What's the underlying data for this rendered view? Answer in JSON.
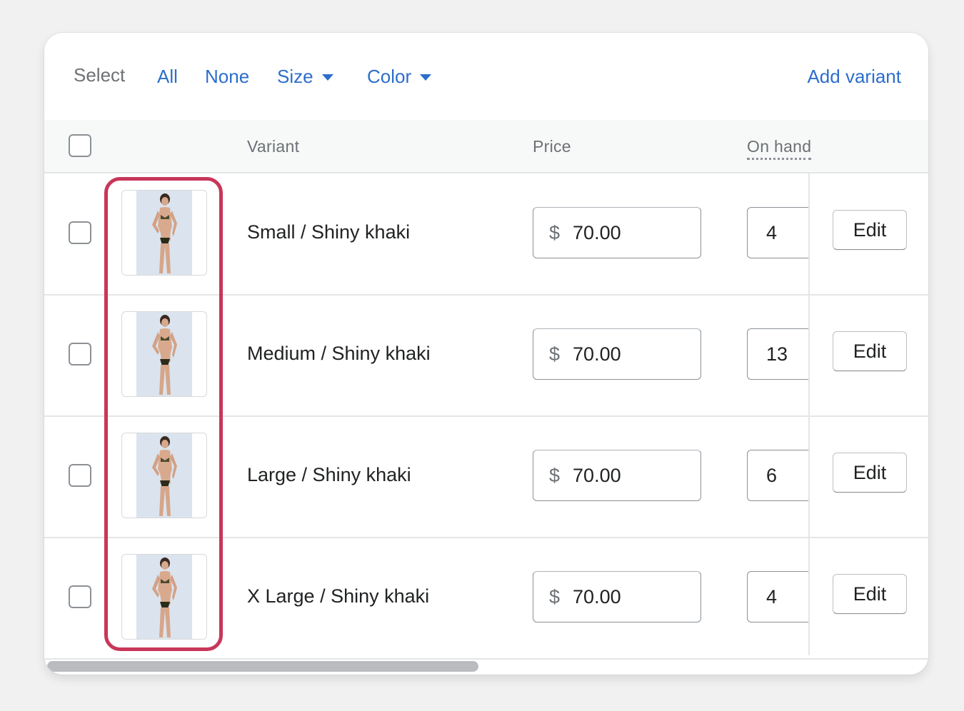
{
  "select_bar": {
    "label": "Select",
    "all": "All",
    "none": "None",
    "size": "Size",
    "color": "Color",
    "add_variant": "Add variant"
  },
  "table": {
    "headers": {
      "variant": "Variant",
      "price": "Price",
      "on_hand": "On hand"
    },
    "rows": [
      {
        "name": "Small / Shiny khaki",
        "currency": "$",
        "price": "70.00",
        "on_hand": "4",
        "edit": "Edit"
      },
      {
        "name": "Medium / Shiny khaki",
        "currency": "$",
        "price": "70.00",
        "on_hand": "13",
        "edit": "Edit"
      },
      {
        "name": "Large / Shiny khaki",
        "currency": "$",
        "price": "70.00",
        "on_hand": "6",
        "edit": "Edit"
      },
      {
        "name": "X Large / Shiny khaki",
        "currency": "$",
        "price": "70.00",
        "on_hand": "4",
        "edit": "Edit"
      }
    ]
  },
  "colors": {
    "link": "#2c6ecb",
    "highlight": "#c8365a",
    "text": "#202223",
    "subdued": "#6d7175"
  }
}
